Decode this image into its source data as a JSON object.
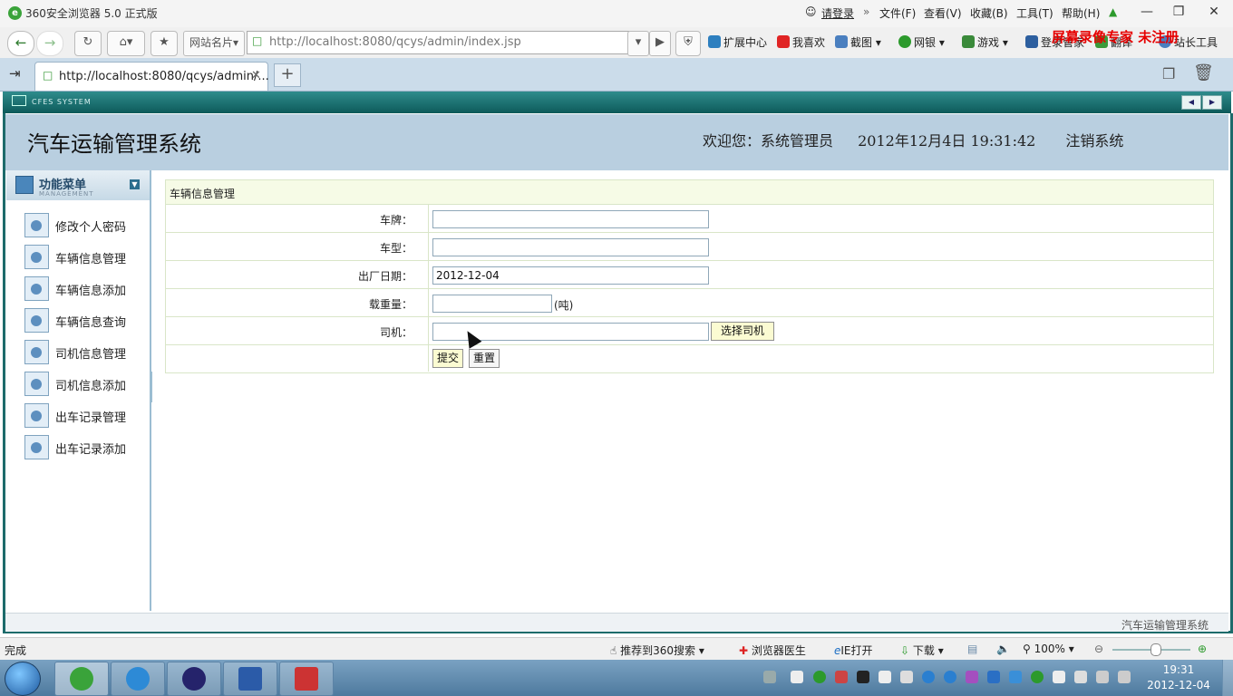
{
  "window": {
    "title": "360安全浏览器 5.0 正式版",
    "login": "请登录",
    "menus": [
      "文件(F)",
      "查看(V)",
      "收藏(B)",
      "工具(T)",
      "帮助(H)"
    ]
  },
  "toolbar": {
    "site_card": "网站名片",
    "address": "http://localhost:8080/qcys/admin/index.jsp",
    "address_host": "localhost",
    "items": [
      "扩展中心",
      "我喜欢",
      "截图",
      "网银",
      "游戏",
      "登录管家",
      "翻译",
      "站长工具"
    ],
    "watermark": "屏幕录像专家 未注册"
  },
  "tabs": [
    {
      "title": "http://localhost:8080/qcys/admin/..."
    }
  ],
  "frame": {
    "strip_text": "CFES SYSTEM"
  },
  "header": {
    "title": "汽车运输管理系统",
    "welcome": "欢迎您：系统管理员",
    "datetime": "2012年12月4日  19:31:42",
    "logout": "注销系统"
  },
  "sidebar": {
    "heading": "功能菜单",
    "heading_sub": "MANAGEMENT",
    "items": [
      {
        "label": "修改个人密码"
      },
      {
        "label": "车辆信息管理"
      },
      {
        "label": "车辆信息添加"
      },
      {
        "label": "车辆信息查询"
      },
      {
        "label": "司机信息管理"
      },
      {
        "label": "司机信息添加"
      },
      {
        "label": "出车记录管理"
      },
      {
        "label": "出车记录添加"
      }
    ]
  },
  "form": {
    "title": "车辆信息管理",
    "plate_label": "车牌：",
    "plate_value": "",
    "model_label": "车型：",
    "model_value": "",
    "date_label": "出厂日期：",
    "date_value": "2012-12-04",
    "load_label": "载重量：",
    "load_value": "",
    "load_unit": "(吨)",
    "driver_label": "司机：",
    "driver_value": "",
    "choose_driver": "选择司机",
    "submit": "提交",
    "reset": "重置"
  },
  "footer": {
    "text": "汽车运输管理系统"
  },
  "statusbar": {
    "status": "完成",
    "recommend": "推荐到360搜索",
    "doctor": "浏览器医生",
    "ie_open": "IE打开",
    "download": "下载",
    "zoom": "100%",
    "zoom_level": 0.5
  },
  "taskbar": {
    "time": "19:31",
    "date": "2012-12-04"
  }
}
